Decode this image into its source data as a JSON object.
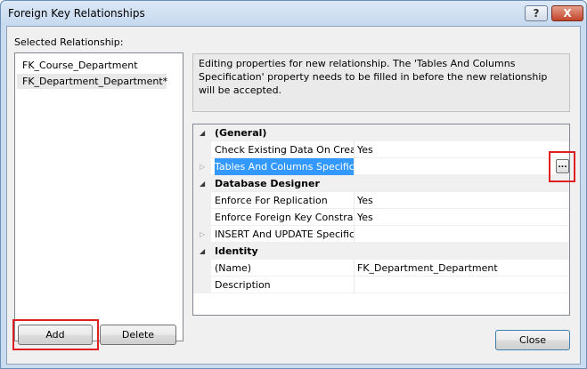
{
  "window": {
    "title": "Foreign Key Relationships",
    "help_label": "?",
    "close_label": "X"
  },
  "left": {
    "label": "Selected Relationship:",
    "items": [
      "FK_Course_Department",
      "FK_Department_Department*"
    ]
  },
  "description": {
    "text": "Editing properties for new relationship.  The 'Tables And Columns Specification' property needs to be filled in before the new relationship will be accepted."
  },
  "grid": {
    "rows": [
      {
        "kind": "category",
        "name": "(General)",
        "value": ""
      },
      {
        "kind": "property",
        "name": "Check Existing Data On Creation Or Re-Enabling",
        "value": "Yes"
      },
      {
        "kind": "expandable",
        "name": "Tables And Columns Specification",
        "value": ""
      },
      {
        "kind": "category",
        "name": "Database Designer",
        "value": ""
      },
      {
        "kind": "property",
        "name": "Enforce For Replication",
        "value": "Yes"
      },
      {
        "kind": "property",
        "name": "Enforce Foreign Key Constraint",
        "value": "Yes"
      },
      {
        "kind": "expandable",
        "name": "INSERT And UPDATE Specification",
        "value": ""
      },
      {
        "kind": "category",
        "name": "Identity",
        "value": ""
      },
      {
        "kind": "property",
        "name": "(Name)",
        "value": "FK_Department_Department"
      },
      {
        "kind": "property",
        "name": "Description",
        "value": ""
      }
    ],
    "ellipsis_label": "..."
  },
  "buttons": {
    "add": "Add",
    "delete": "Delete",
    "close": "Close"
  },
  "colors": {
    "selection": "#3399ff",
    "highlight": "#e02020"
  },
  "icons": {
    "expanded": "triangle-down-icon",
    "collapsed": "triangle-right-icon"
  }
}
